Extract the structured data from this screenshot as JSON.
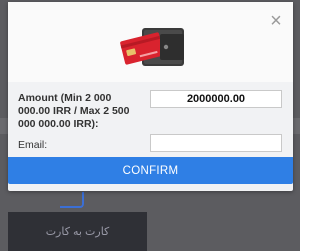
{
  "modal": {
    "close_glyph": "×",
    "amount_label": "Amount (Min 2 000 000.00 IRR / Max 2 500 000 000.00 IRR):",
    "amount_value": "2000000.00",
    "email_label": "Email:",
    "email_value": "",
    "email_placeholder": "",
    "confirm_label": "CONFIRM"
  },
  "background": {
    "card_button_label": "کارت به کارت"
  },
  "colors": {
    "accent": "#2f7fe5",
    "overlay": "#5c5c60",
    "card_red": "#d9232e"
  },
  "icons": [
    "close-icon",
    "wallet-card-icon",
    "card-to-card-icon"
  ]
}
